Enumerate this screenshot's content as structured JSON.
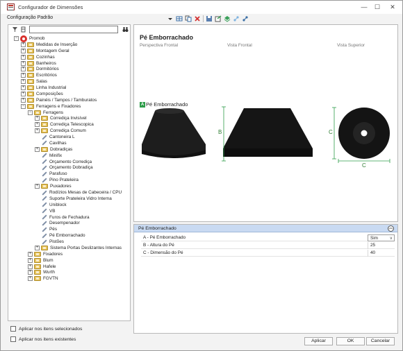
{
  "window": {
    "title": "Configurador de Dimensões",
    "minimize": "—",
    "maximize": "☐",
    "close": "✕"
  },
  "toolbar": {
    "config_label": "Configuração Padrão",
    "icons": [
      "dropdown-arrow-icon",
      "grid-table-icon",
      "copy-icon",
      "delete-icon",
      "save-icon",
      "export-icon",
      "layers-icon",
      "link-icon",
      "unlink-icon"
    ]
  },
  "tree": {
    "search_value": "",
    "nodes": [
      {
        "label": "Promob",
        "depth": 0,
        "type": "root",
        "expander": "−"
      },
      {
        "label": "Medidas de Inserção",
        "depth": 1,
        "type": "folder",
        "expander": "+"
      },
      {
        "label": "Montagem Geral",
        "depth": 1,
        "type": "folder",
        "expander": "+"
      },
      {
        "label": "Cozinhas",
        "depth": 1,
        "type": "folder",
        "expander": "+"
      },
      {
        "label": "Banheiros",
        "depth": 1,
        "type": "folder",
        "expander": "+"
      },
      {
        "label": "Dormitórios",
        "depth": 1,
        "type": "folder",
        "expander": "+"
      },
      {
        "label": "Escritórios",
        "depth": 1,
        "type": "folder",
        "expander": "+"
      },
      {
        "label": "Salas",
        "depth": 1,
        "type": "folder",
        "expander": "+"
      },
      {
        "label": "Linha Industrial",
        "depth": 1,
        "type": "folder",
        "expander": "+"
      },
      {
        "label": "Composições",
        "depth": 1,
        "type": "folder",
        "expander": "+"
      },
      {
        "label": "Painéis / Tampos / Tamburatos",
        "depth": 1,
        "type": "folder",
        "expander": "+"
      },
      {
        "label": "Ferragens e Fixadores",
        "depth": 1,
        "type": "folder",
        "expander": "−"
      },
      {
        "label": "Ferragens",
        "depth": 2,
        "type": "folder",
        "expander": "−"
      },
      {
        "label": "Corrediça Invisível",
        "depth": 3,
        "type": "folder",
        "expander": "+"
      },
      {
        "label": "Corrediça Telescopica",
        "depth": 3,
        "type": "folder",
        "expander": "+"
      },
      {
        "label": "Corrediça Comum",
        "depth": 3,
        "type": "folder",
        "expander": "+"
      },
      {
        "label": "Cantoneira L",
        "depth": 3,
        "type": "leaf",
        "expander": ""
      },
      {
        "label": "Cavilhas",
        "depth": 3,
        "type": "leaf",
        "expander": ""
      },
      {
        "label": "Dobradiças",
        "depth": 3,
        "type": "folder",
        "expander": "+"
      },
      {
        "label": "Minifix",
        "depth": 3,
        "type": "leaf",
        "expander": ""
      },
      {
        "label": "Orçamento Corrediça",
        "depth": 3,
        "type": "leaf",
        "expander": ""
      },
      {
        "label": "Orçamento Dobradiça",
        "depth": 3,
        "type": "leaf",
        "expander": ""
      },
      {
        "label": "Parafuso",
        "depth": 3,
        "type": "leaf",
        "expander": ""
      },
      {
        "label": "Pino Prateleira",
        "depth": 3,
        "type": "leaf",
        "expander": ""
      },
      {
        "label": "Puxadores",
        "depth": 3,
        "type": "folder",
        "expander": "+"
      },
      {
        "label": "Rodízios Mesas de Cabeceira / CPU",
        "depth": 3,
        "type": "leaf",
        "expander": ""
      },
      {
        "label": "Suporte Prateleira Vidro Interna",
        "depth": 3,
        "type": "leaf",
        "expander": ""
      },
      {
        "label": "Uniblock",
        "depth": 3,
        "type": "leaf",
        "expander": ""
      },
      {
        "label": "VB",
        "depth": 3,
        "type": "leaf",
        "expander": ""
      },
      {
        "label": "Furos de Fechadura",
        "depth": 3,
        "type": "leaf",
        "expander": ""
      },
      {
        "label": "Desempenador",
        "depth": 3,
        "type": "leaf",
        "expander": ""
      },
      {
        "label": "Pés",
        "depth": 3,
        "type": "leaf",
        "expander": ""
      },
      {
        "label": "Pé Emborrachado",
        "depth": 3,
        "type": "leaf",
        "expander": ""
      },
      {
        "label": "Pistões",
        "depth": 3,
        "type": "leaf",
        "expander": ""
      },
      {
        "label": "Sistema Portas Deslizantes Internas",
        "depth": 3,
        "type": "folder",
        "expander": "+"
      },
      {
        "label": "Fixadores",
        "depth": 2,
        "type": "folder",
        "expander": "+"
      },
      {
        "label": "Blum",
        "depth": 2,
        "type": "folder",
        "expander": "+"
      },
      {
        "label": "Hafele",
        "depth": 2,
        "type": "folder",
        "expander": "+"
      },
      {
        "label": "Wurth",
        "depth": 2,
        "type": "folder",
        "expander": "+"
      },
      {
        "label": "FGVTN",
        "depth": 2,
        "type": "folder",
        "expander": "+"
      }
    ]
  },
  "options": {
    "apply_selected": "Aplicar nos itens selecionados",
    "apply_existing": "Aplicar nos itens existentes"
  },
  "preview": {
    "title": "Pé Emborrachado",
    "views": [
      "Perspectiva Frontal",
      "Vista Frontal",
      "Vista Superior"
    ],
    "tag_letter": "A",
    "tag_text": "Pé Emborrachado",
    "dim_b": "B",
    "dim_c_side": "C",
    "dim_c_bottom": "C"
  },
  "properties": {
    "header": "Pé Emborrachado",
    "collapse_symbol": "︽",
    "rows": [
      {
        "name": "A - Pé Emborrachado",
        "value": "Sim",
        "dropdown": "∨"
      },
      {
        "name": "B - Altura do Pé",
        "value": "25"
      },
      {
        "name": "C - Dimensão do Pé",
        "value": "40"
      }
    ]
  },
  "buttons": {
    "apply": "Aplicar",
    "ok": "OK",
    "cancel": "Cancelar"
  },
  "colors": {
    "accent": "#2e9c4a",
    "header": "#c9daf2"
  }
}
